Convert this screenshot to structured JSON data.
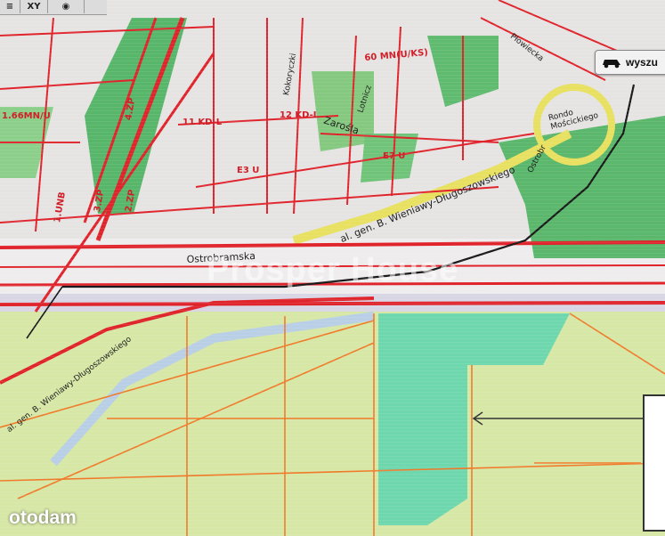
{
  "toolbar": {
    "xy_label": "XY"
  },
  "search": {
    "label": "wyszu"
  },
  "labels": {
    "street_ostrobramska": "Ostrobramska",
    "street_wieniawy_main": "al. gen. B. Wieniawy-Długoszowskiego",
    "street_wieniawy_lower": "al. gen. B. Wieniawy-Długoszowskiego",
    "street_zarosla": "Zarośla",
    "street_lotnicza": "Lotnicz",
    "street_kokoryczki": "Kokoryczki",
    "street_plowiecka": "Płowiecka",
    "street_ostrobramska_ramp": "Ostrobr",
    "roundabout": "Rondo Mościckiego",
    "zone_e3u": "E3 U",
    "zone_e7u": "E7 U",
    "zone_11kdl": "11 KD-L",
    "zone_12kdl": "12 KD-L",
    "zone_4zp": "4.ZP",
    "zone_3zp": "3.ZP",
    "zone_2zp": "2.ZP",
    "zone_1unb": "1.UNB",
    "zone_66mnu": "1.66MN/U",
    "zone_top": "60 MN(U/KS)"
  },
  "watermark": "Prosper House",
  "logo": "otodam",
  "colors": {
    "red_lines": "#e0242c",
    "orange_lines": "#f07a2a",
    "road_yellow": "#e8e060",
    "green_zone": "#54b567",
    "teal_plot": "#6fd6a8",
    "light_green": "#d4e8a4",
    "route_black": "#1a1a1a"
  }
}
